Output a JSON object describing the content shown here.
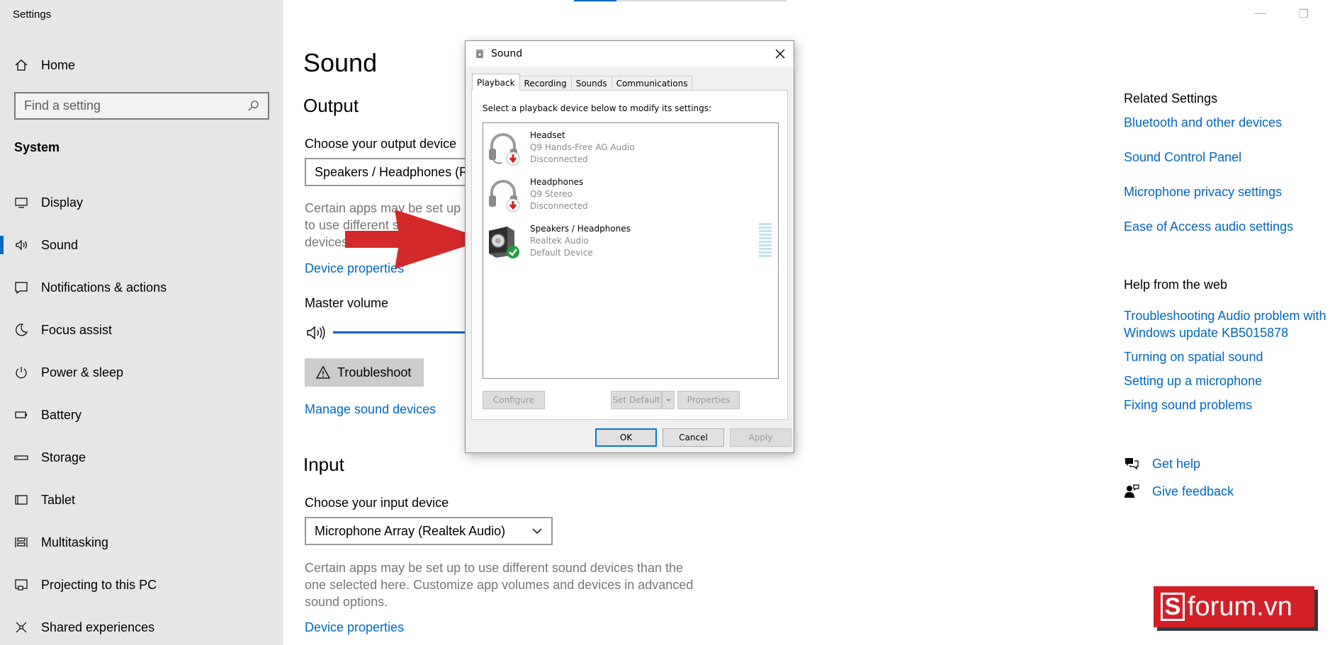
{
  "app": {
    "title": "Settings"
  },
  "sidebar": {
    "home": "Home",
    "search_placeholder": "Find a setting",
    "section": "System",
    "items": [
      {
        "label": "Display",
        "icon": "monitor-icon"
      },
      {
        "label": "Sound",
        "icon": "speaker-icon",
        "active": true
      },
      {
        "label": "Notifications & actions",
        "icon": "notification-icon"
      },
      {
        "label": "Focus assist",
        "icon": "moon-icon"
      },
      {
        "label": "Power & sleep",
        "icon": "power-icon"
      },
      {
        "label": "Battery",
        "icon": "battery-icon"
      },
      {
        "label": "Storage",
        "icon": "storage-icon"
      },
      {
        "label": "Tablet",
        "icon": "tablet-icon"
      },
      {
        "label": "Multitasking",
        "icon": "multitasking-icon"
      },
      {
        "label": "Projecting to this PC",
        "icon": "projector-icon"
      },
      {
        "label": "Shared experiences",
        "icon": "share-icon"
      }
    ]
  },
  "main": {
    "title": "Sound",
    "output": {
      "heading": "Output",
      "choose_label": "Choose your output device",
      "selected_device": "Speakers / Headphones (Realtek Audio)",
      "desc": "Certain apps may be set up to use different sound devices than the one selected here. Customize app volumes and devices in advanced sound options.",
      "device_properties": "Device properties",
      "master_volume": "Master volume",
      "troubleshoot": "Troubleshoot",
      "manage_devices": "Manage sound devices"
    },
    "input": {
      "heading": "Input",
      "choose_label": "Choose your input device",
      "selected_device": "Microphone Array (Realtek Audio)",
      "desc": "Certain apps may be set up to use different sound devices than the one selected here. Customize app volumes and devices in advanced sound options.",
      "device_properties": "Device properties"
    }
  },
  "right": {
    "related_heading": "Related Settings",
    "related_links": [
      "Bluetooth and other devices",
      "Sound Control Panel",
      "Microphone privacy settings",
      "Ease of Access audio settings"
    ],
    "help_heading": "Help from the web",
    "help_links": [
      "Troubleshooting Audio problem with Windows update KB5015878",
      "Turning on spatial sound",
      "Setting up a microphone",
      "Fixing sound problems"
    ],
    "get_help": "Get help",
    "give_feedback": "Give feedback"
  },
  "dialog": {
    "title": "Sound",
    "tabs": [
      "Playback",
      "Recording",
      "Sounds",
      "Communications"
    ],
    "instruction": "Select a playback device below to modify its settings:",
    "devices": [
      {
        "name": "Headset",
        "desc": "Q9 Hands-Free AG Audio",
        "status": "Disconnected"
      },
      {
        "name": "Headphones",
        "desc": "Q9 Stereo",
        "status": "Disconnected"
      },
      {
        "name": "Speakers / Headphones",
        "desc": "Realtek Audio",
        "status": "Default Device"
      }
    ],
    "buttons": {
      "configure": "Configure",
      "set_default": "Set Default",
      "properties": "Properties",
      "ok": "OK",
      "cancel": "Cancel",
      "apply": "Apply"
    }
  },
  "watermark": {
    "letter": "S",
    "text": "forum.vn"
  },
  "colors": {
    "accent": "#0067c0",
    "sidebar_bg": "#e6e6e6",
    "arrow": "#d42a2a",
    "watermark": "#d32027"
  }
}
